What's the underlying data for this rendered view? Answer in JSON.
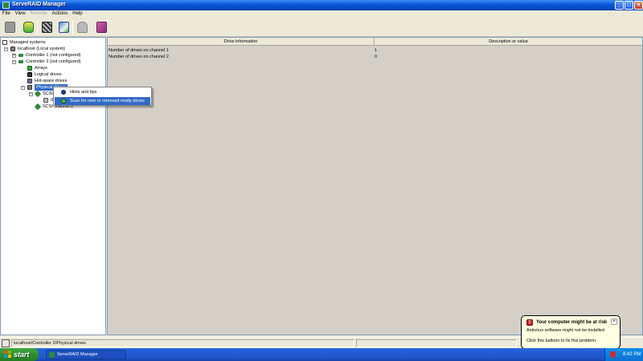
{
  "window": {
    "title": "ServeRAID Manager"
  },
  "menu": [
    {
      "label": "File",
      "disabled": false
    },
    {
      "label": "View",
      "disabled": false
    },
    {
      "label": "Remote",
      "disabled": true
    },
    {
      "label": "Actions",
      "disabled": false
    },
    {
      "label": "Help",
      "disabled": false
    }
  ],
  "toolbar": {
    "buttons": [
      "open-icon",
      "database-icon",
      "raid-config-icon",
      "search-drives-icon",
      "bell-icon",
      "book-icon"
    ]
  },
  "tree": {
    "root": "Managed systems",
    "system": "localhost (Local system)",
    "controller1": "Controller 1 (not configured)",
    "controller2": "Controller 2 (not configured)",
    "arrays": "Arrays",
    "logical": "Logical drives",
    "hotspare": "Hot-spare drives",
    "physical": "Physical drives",
    "scsi1": "SCSI channel 1",
    "scsi1_child": "ID 0",
    "scsi2": "SCSI channel 2"
  },
  "table": {
    "headers": [
      "Drive information",
      "Description or value"
    ],
    "rows": [
      {
        "info": "Number of drives on channel 1",
        "value": "1"
      },
      {
        "info": "Number of drives on channel 2",
        "value": "0"
      }
    ]
  },
  "context_menu": {
    "items": [
      {
        "label": "Hints and tips"
      },
      {
        "label": "Scan for new or removed ready drives"
      }
    ]
  },
  "status": {
    "path": "localhost/Controller 2/Physical drives"
  },
  "balloon": {
    "title": "Your computer might be at risk",
    "line1": "Antivirus software might not be installed",
    "line2": "Click this balloon to fix this problem."
  },
  "taskbar": {
    "start": "start",
    "task": "ServeRAID Manager",
    "clock": "8:42 PM"
  },
  "colors": {
    "selection": "#316ac5",
    "taskbar": "#245edb",
    "start": "#3fa83f"
  }
}
